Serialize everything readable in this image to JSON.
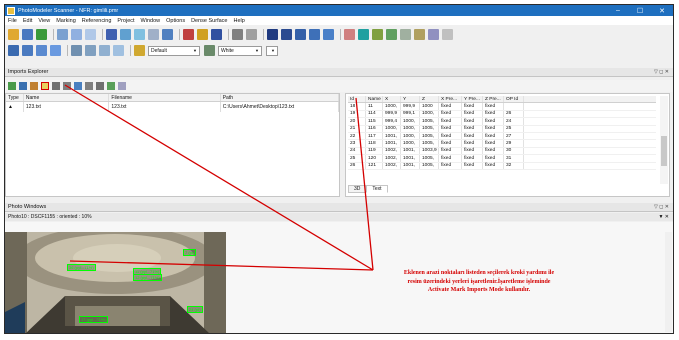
{
  "window": {
    "title": "PhotoModeler Scanner - NFR: gimlili.pmr",
    "controls": [
      "–",
      "☐",
      "✕"
    ]
  },
  "menu": [
    "File",
    "Edit",
    "View",
    "Marking",
    "Referencing",
    "Project",
    "Window",
    "Options",
    "Dense Surface",
    "Help"
  ],
  "toolbar2": {
    "display_combo": "Default",
    "color_combo": "White"
  },
  "imports_explorer": {
    "title": "Imports Explorer",
    "header_controls": "▽ ◻ ✕",
    "columns": [
      "Type",
      "Name",
      "Filename",
      "Path"
    ],
    "rows": [
      {
        "type": "▲",
        "name": "123.txt",
        "filename": "123.txt",
        "path": "C:\\Users\\Ahmet\\Desktop\\123.txt"
      }
    ]
  },
  "points_table": {
    "columns": [
      "Id",
      "Name",
      "X",
      "Y",
      "Z",
      "X Pre...",
      "Y Pre...",
      "Z Pre...",
      "OP Id"
    ],
    "rows": [
      [
        "18",
        "11",
        "1000,",
        "999,9",
        "1000",
        "fixed",
        "fixed",
        "fixed",
        ""
      ],
      [
        "19",
        "114",
        "999,9",
        "999,1",
        "1000,",
        "fixed",
        "fixed",
        "fixed",
        "26"
      ],
      [
        "20",
        "115",
        "999,4",
        "1000,",
        "1005,",
        "fixed",
        "fixed",
        "fixed",
        "24"
      ],
      [
        "21",
        "116",
        "1000,",
        "1000,",
        "1005,",
        "fixed",
        "fixed",
        "fixed",
        "25"
      ],
      [
        "22",
        "117",
        "1001,",
        "1000,",
        "1005,",
        "fixed",
        "fixed",
        "fixed",
        "27"
      ],
      [
        "23",
        "118",
        "1001,",
        "1000,",
        "1005,",
        "fixed",
        "fixed",
        "fixed",
        "29"
      ],
      [
        "24",
        "119",
        "1002,",
        "1001,",
        "1003,9",
        "fixed",
        "fixed",
        "fixed",
        "30"
      ],
      [
        "25",
        "120",
        "1002,",
        "1001,",
        "1005,",
        "fixed",
        "fixed",
        "fixed",
        "31"
      ],
      [
        "26",
        "121",
        "1002,",
        "1001,",
        "1005,",
        "fixed",
        "fixed",
        "fixed",
        "32"
      ]
    ],
    "tabs": [
      "3D",
      "Text"
    ]
  },
  "photo_windows": {
    "title": "Photo Windows",
    "header_controls": "▽ ◻ ✕",
    "photo_caption": "Photo10 : DSCF1155 : oriented : 10%",
    "markers": [
      "7 (pt)",
      "36 (pyl...71%)",
      "11 (pyl...71%)",
      "12 (pyl...71%)",
      "24 (pt)",
      "17 (pyl...71%)"
    ]
  },
  "annotation": {
    "lines": [
      "Eklenen arazi noktaları listeden seçilerek kroki yardımı ile",
      "resim üzerindeki yerleri işaretlenir.İşaretleme işleminde",
      "Activate Mark Imports Mode kullanılır."
    ]
  },
  "colors": {
    "title_bar": "#1e6fbf",
    "annotation": "#d40000",
    "marker": "#00ff00"
  }
}
